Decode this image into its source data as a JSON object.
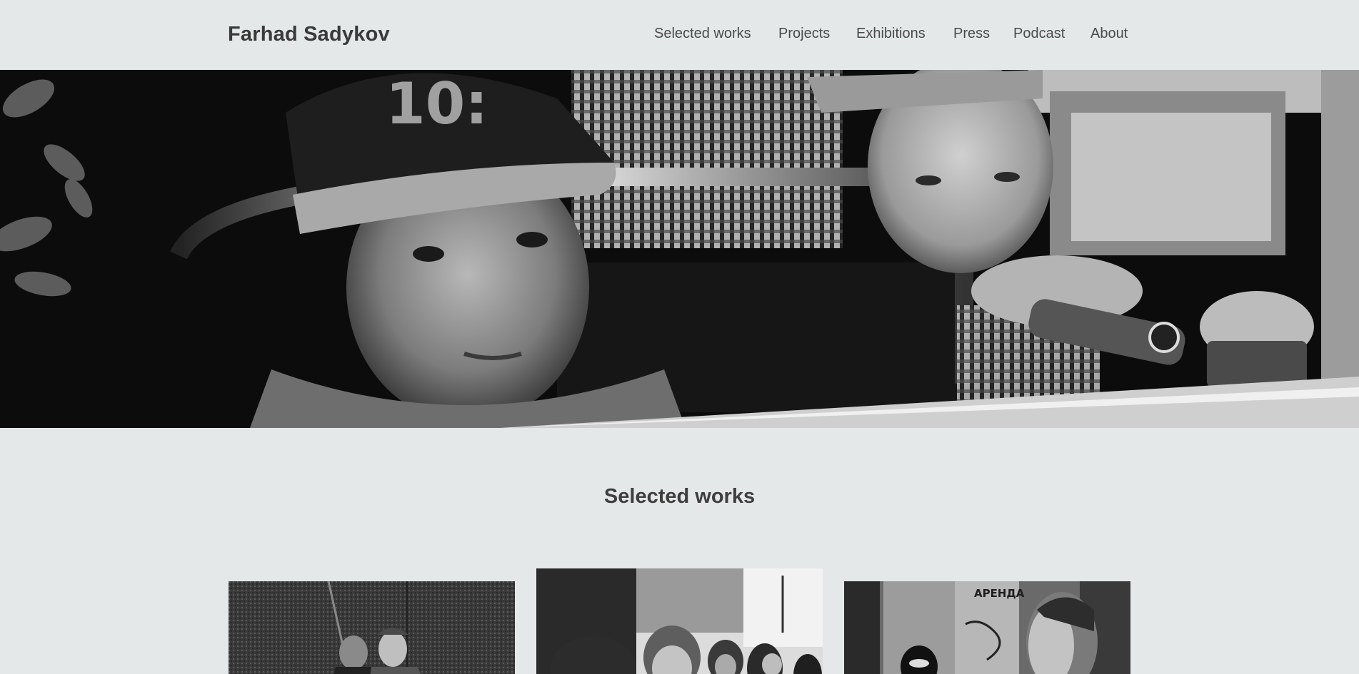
{
  "site": {
    "title": "Farhad Sadykov"
  },
  "nav": {
    "items": [
      {
        "label": "Selected works"
      },
      {
        "label": "Projects"
      },
      {
        "label": "Exhibitions"
      },
      {
        "label": "Press"
      },
      {
        "label": "Podcast"
      },
      {
        "label": "About"
      }
    ]
  },
  "hero": {
    "image": "hero-photo-children-on-tram"
  },
  "selected_works": {
    "title": "Selected works",
    "items": [
      {
        "image": "photo-elderly-couple"
      },
      {
        "image": "photo-girl-in-crowd"
      },
      {
        "image": "photo-man-passing-graffiti",
        "graffiti_text": "АРЕНДА"
      }
    ]
  },
  "colors": {
    "background": "#e4e8e9",
    "text": "#3e3e3e"
  }
}
